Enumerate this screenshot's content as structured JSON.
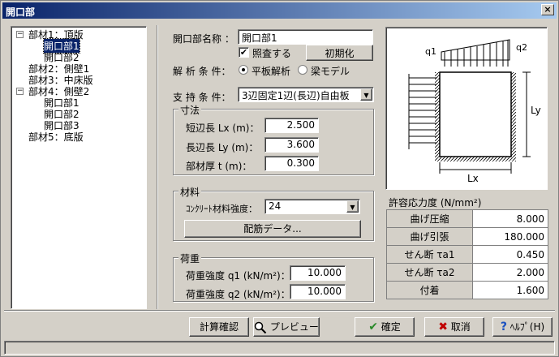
{
  "window": {
    "title": "開口部"
  },
  "tree": {
    "items": [
      {
        "label": "部材1：頂版",
        "expander": "−"
      },
      {
        "label": "開口部1"
      },
      {
        "label": "開口部2"
      },
      {
        "label": "部材2：側壁1"
      },
      {
        "label": "部材3：中床版"
      },
      {
        "label": "部材4：側壁2",
        "expander": "−"
      },
      {
        "label": "開口部1"
      },
      {
        "label": "開口部2"
      },
      {
        "label": "開口部3"
      },
      {
        "label": "部材5：底版"
      }
    ]
  },
  "form": {
    "name_label": "開口部名称 ：",
    "name_value": "開口部1",
    "check_label": "照査する",
    "check_mark": "✔",
    "init_button": "初期化",
    "analysis_label": "解 析 条 件：",
    "analysis_options": [
      "平板解析",
      "梁モデル"
    ],
    "support_label": "支 持 条 件：",
    "support_value": "3辺固定1辺(長辺)自由板",
    "dims": {
      "title": "寸法",
      "short_label": "短辺長 Lx (m)：",
      "short_value": "2.500",
      "long_label": "長辺長 Ly (m)：",
      "long_value": "3.600",
      "thick_label": "部材厚 t  (m)：",
      "thick_value": "0.300"
    },
    "material": {
      "title": "材料",
      "concrete_label": "ｺﾝｸﾘｰﾄ材料強度：",
      "concrete_value": "24",
      "rebar_button": "配筋データ..."
    },
    "load": {
      "title": "荷重",
      "q1_label": "荷重強度 q1 (kN/m²)：",
      "q1_value": "10.000",
      "q2_label": "荷重強度 q2 (kN/m²)：",
      "q2_value": "10.000"
    }
  },
  "diagram": {
    "q1": "q1",
    "q2": "q2",
    "lx": "Lx",
    "ly": "Ly"
  },
  "stress": {
    "title": "許容応力度 (N/mm²)",
    "rows": [
      {
        "label": "曲げ圧縮",
        "value": "8.000"
      },
      {
        "label": "曲げ引張",
        "value": "180.000"
      },
      {
        "label": "せん断 τa1",
        "value": "0.450"
      },
      {
        "label": "せん断 τa2",
        "value": "2.000"
      },
      {
        "label": "付着",
        "value": "1.600"
      }
    ]
  },
  "buttons": {
    "calc": "計算確認",
    "preview": "プレビュー",
    "ok": "確定",
    "cancel": "取消",
    "help": "ﾍﾙﾌﾟ(H)"
  },
  "icons": {
    "combo_arrow": "▼",
    "close": "×",
    "ok": "✔",
    "cancel": "✖",
    "help": "?"
  },
  "colors": {
    "title_start": "#0a246a",
    "title_end": "#a6caf0",
    "selection": "#0a246a",
    "ok_icon": "#2a8a2a",
    "cancel_icon": "#c00000",
    "help_icon": "#1a50c0"
  }
}
